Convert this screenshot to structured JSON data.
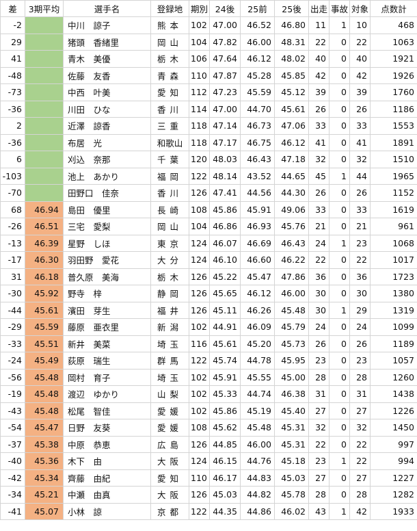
{
  "table": {
    "headers": [
      "差",
      "3期平均",
      "選手名",
      "登録地",
      "期別",
      "24後",
      "25前",
      "25後",
      "出走",
      "事故",
      "対象",
      "点数計"
    ],
    "rows": [
      {
        "diff": "-2",
        "avg": "",
        "avg_color": "green",
        "name": "中川　諒子",
        "pref": "熊本",
        "term": "102",
        "s24b": "47.00",
        "s25a": "46.52",
        "s25b": "46.80",
        "starts": "11",
        "accidents": "1",
        "target": "10",
        "points": "468"
      },
      {
        "diff": "29",
        "avg": "",
        "avg_color": "green",
        "name": "猪頭　香緒里",
        "pref": "岡山",
        "term": "104",
        "s24b": "47.82",
        "s25a": "46.00",
        "s25b": "48.31",
        "starts": "22",
        "accidents": "0",
        "target": "22",
        "points": "1063"
      },
      {
        "diff": "41",
        "avg": "",
        "avg_color": "green",
        "name": "青木　美優",
        "pref": "栃木",
        "term": "106",
        "s24b": "47.64",
        "s25a": "46.12",
        "s25b": "48.02",
        "starts": "40",
        "accidents": "0",
        "target": "40",
        "points": "1921"
      },
      {
        "diff": "-48",
        "avg": "",
        "avg_color": "green",
        "name": "佐藤　友香",
        "pref": "青森",
        "term": "110",
        "s24b": "47.87",
        "s25a": "45.28",
        "s25b": "45.85",
        "starts": "42",
        "accidents": "0",
        "target": "42",
        "points": "1926"
      },
      {
        "diff": "-73",
        "avg": "",
        "avg_color": "green",
        "name": "中西　叶美",
        "pref": "愛知",
        "term": "112",
        "s24b": "47.23",
        "s25a": "45.59",
        "s25b": "45.12",
        "starts": "39",
        "accidents": "0",
        "target": "39",
        "points": "1760"
      },
      {
        "diff": "-36",
        "avg": "",
        "avg_color": "green",
        "name": "川田　ひな",
        "pref": "香川",
        "term": "114",
        "s24b": "47.00",
        "s25a": "44.70",
        "s25b": "45.61",
        "starts": "26",
        "accidents": "0",
        "target": "26",
        "points": "1186"
      },
      {
        "diff": "2",
        "avg": "",
        "avg_color": "green",
        "name": "近澤　諒香",
        "pref": "三重",
        "term": "118",
        "s24b": "47.14",
        "s25a": "46.73",
        "s25b": "47.06",
        "starts": "33",
        "accidents": "0",
        "target": "33",
        "points": "1553"
      },
      {
        "diff": "-36",
        "avg": "",
        "avg_color": "green",
        "name": "布居　光",
        "pref": "和歌山",
        "term": "118",
        "s24b": "47.17",
        "s25a": "46.75",
        "s25b": "46.12",
        "starts": "41",
        "accidents": "0",
        "target": "41",
        "points": "1891"
      },
      {
        "diff": "6",
        "avg": "",
        "avg_color": "green",
        "name": "刈込　奈那",
        "pref": "千葉",
        "term": "120",
        "s24b": "48.03",
        "s25a": "46.43",
        "s25b": "47.18",
        "starts": "32",
        "accidents": "0",
        "target": "32",
        "points": "1510"
      },
      {
        "diff": "-103",
        "avg": "",
        "avg_color": "green",
        "name": "池上　あかり",
        "pref": "福岡",
        "term": "122",
        "s24b": "48.14",
        "s25a": "43.52",
        "s25b": "44.65",
        "starts": "45",
        "accidents": "1",
        "target": "44",
        "points": "1965"
      },
      {
        "diff": "-70",
        "avg": "",
        "avg_color": "green",
        "name": "田野口　佳奈",
        "pref": "香川",
        "term": "126",
        "s24b": "47.41",
        "s25a": "44.56",
        "s25b": "44.30",
        "starts": "26",
        "accidents": "0",
        "target": "26",
        "points": "1152"
      },
      {
        "diff": "68",
        "avg": "46.94",
        "avg_color": "orange",
        "name": "島田　優里",
        "pref": "長崎",
        "term": "108",
        "s24b": "45.86",
        "s25a": "45.91",
        "s25b": "49.06",
        "starts": "33",
        "accidents": "0",
        "target": "33",
        "points": "1619"
      },
      {
        "diff": "-26",
        "avg": "46.51",
        "avg_color": "orange",
        "name": "三宅　愛梨",
        "pref": "岡山",
        "term": "104",
        "s24b": "46.86",
        "s25a": "46.93",
        "s25b": "45.76",
        "starts": "21",
        "accidents": "0",
        "target": "21",
        "points": "961"
      },
      {
        "diff": "-13",
        "avg": "46.39",
        "avg_color": "orange",
        "name": "星野　しほ",
        "pref": "東京",
        "term": "124",
        "s24b": "46.07",
        "s25a": "46.69",
        "s25b": "46.43",
        "starts": "24",
        "accidents": "1",
        "target": "23",
        "points": "1068"
      },
      {
        "diff": "-17",
        "avg": "46.30",
        "avg_color": "orange",
        "name": "羽田野　愛花",
        "pref": "大分",
        "term": "124",
        "s24b": "46.10",
        "s25a": "46.60",
        "s25b": "46.22",
        "starts": "22",
        "accidents": "0",
        "target": "22",
        "points": "1017"
      },
      {
        "diff": "31",
        "avg": "46.18",
        "avg_color": "orange",
        "name": "普久原　美海",
        "pref": "栃木",
        "term": "126",
        "s24b": "45.22",
        "s25a": "45.47",
        "s25b": "47.86",
        "starts": "36",
        "accidents": "0",
        "target": "36",
        "points": "1723"
      },
      {
        "diff": "-30",
        "avg": "45.92",
        "avg_color": "orange",
        "name": "野寺　梓",
        "pref": "静岡",
        "term": "126",
        "s24b": "45.65",
        "s25a": "46.12",
        "s25b": "46.00",
        "starts": "30",
        "accidents": "0",
        "target": "30",
        "points": "1380"
      },
      {
        "diff": "-44",
        "avg": "45.61",
        "avg_color": "orange",
        "name": "濱田　芽生",
        "pref": "福井",
        "term": "126",
        "s24b": "45.11",
        "s25a": "46.26",
        "s25b": "45.48",
        "starts": "30",
        "accidents": "1",
        "target": "29",
        "points": "1319"
      },
      {
        "diff": "-29",
        "avg": "45.59",
        "avg_color": "orange",
        "name": "藤原　亜衣里",
        "pref": "新潟",
        "term": "102",
        "s24b": "44.91",
        "s25a": "46.09",
        "s25b": "45.79",
        "starts": "24",
        "accidents": "0",
        "target": "24",
        "points": "1099"
      },
      {
        "diff": "-33",
        "avg": "45.51",
        "avg_color": "orange",
        "name": "新井　美菜",
        "pref": "埼玉",
        "term": "116",
        "s24b": "45.61",
        "s25a": "45.20",
        "s25b": "45.73",
        "starts": "26",
        "accidents": "0",
        "target": "26",
        "points": "1189"
      },
      {
        "diff": "-24",
        "avg": "45.49",
        "avg_color": "orange",
        "name": "荻原　瑞生",
        "pref": "群馬",
        "term": "122",
        "s24b": "45.74",
        "s25a": "44.78",
        "s25b": "45.95",
        "starts": "23",
        "accidents": "0",
        "target": "23",
        "points": "1057"
      },
      {
        "diff": "-56",
        "avg": "45.48",
        "avg_color": "orange",
        "name": "岡村　育子",
        "pref": "埼玉",
        "term": "102",
        "s24b": "45.91",
        "s25a": "45.55",
        "s25b": "45.00",
        "starts": "28",
        "accidents": "0",
        "target": "28",
        "points": "1260"
      },
      {
        "diff": "-19",
        "avg": "45.48",
        "avg_color": "orange",
        "name": "渡辺　ゆかり",
        "pref": "山梨",
        "term": "102",
        "s24b": "45.33",
        "s25a": "44.74",
        "s25b": "46.38",
        "starts": "31",
        "accidents": "0",
        "target": "31",
        "points": "1438"
      },
      {
        "diff": "-43",
        "avg": "45.48",
        "avg_color": "orange",
        "name": "松尾　智佳",
        "pref": "愛媛",
        "term": "102",
        "s24b": "45.86",
        "s25a": "45.19",
        "s25b": "45.40",
        "starts": "27",
        "accidents": "0",
        "target": "27",
        "points": "1226"
      },
      {
        "diff": "-54",
        "avg": "45.47",
        "avg_color": "orange",
        "name": "日野　友葵",
        "pref": "愛媛",
        "term": "108",
        "s24b": "45.62",
        "s25a": "45.48",
        "s25b": "45.31",
        "starts": "32",
        "accidents": "0",
        "target": "32",
        "points": "1450"
      },
      {
        "diff": "-37",
        "avg": "45.38",
        "avg_color": "orange",
        "name": "中原　恭恵",
        "pref": "広島",
        "term": "126",
        "s24b": "44.85",
        "s25a": "46.00",
        "s25b": "45.31",
        "starts": "22",
        "accidents": "0",
        "target": "22",
        "points": "997"
      },
      {
        "diff": "-40",
        "avg": "45.36",
        "avg_color": "orange",
        "name": "木下　由",
        "pref": "大阪",
        "term": "124",
        "s24b": "46.15",
        "s25a": "44.76",
        "s25b": "45.18",
        "starts": "23",
        "accidents": "1",
        "target": "22",
        "points": "994"
      },
      {
        "diff": "-42",
        "avg": "45.34",
        "avg_color": "orange",
        "name": "齊藤　由紀",
        "pref": "愛知",
        "term": "110",
        "s24b": "46.17",
        "s25a": "44.83",
        "s25b": "45.03",
        "starts": "27",
        "accidents": "0",
        "target": "27",
        "points": "1227"
      },
      {
        "diff": "-34",
        "avg": "45.21",
        "avg_color": "orange",
        "name": "中瀬　由真",
        "pref": "大阪",
        "term": "126",
        "s24b": "45.03",
        "s25a": "44.82",
        "s25b": "45.78",
        "starts": "28",
        "accidents": "0",
        "target": "28",
        "points": "1282"
      },
      {
        "diff": "-41",
        "avg": "45.07",
        "avg_color": "orange",
        "name": "小林　諒",
        "pref": "京都",
        "term": "122",
        "s24b": "44.35",
        "s25a": "44.86",
        "s25b": "46.02",
        "starts": "43",
        "accidents": "1",
        "target": "42",
        "points": "1933"
      }
    ]
  }
}
